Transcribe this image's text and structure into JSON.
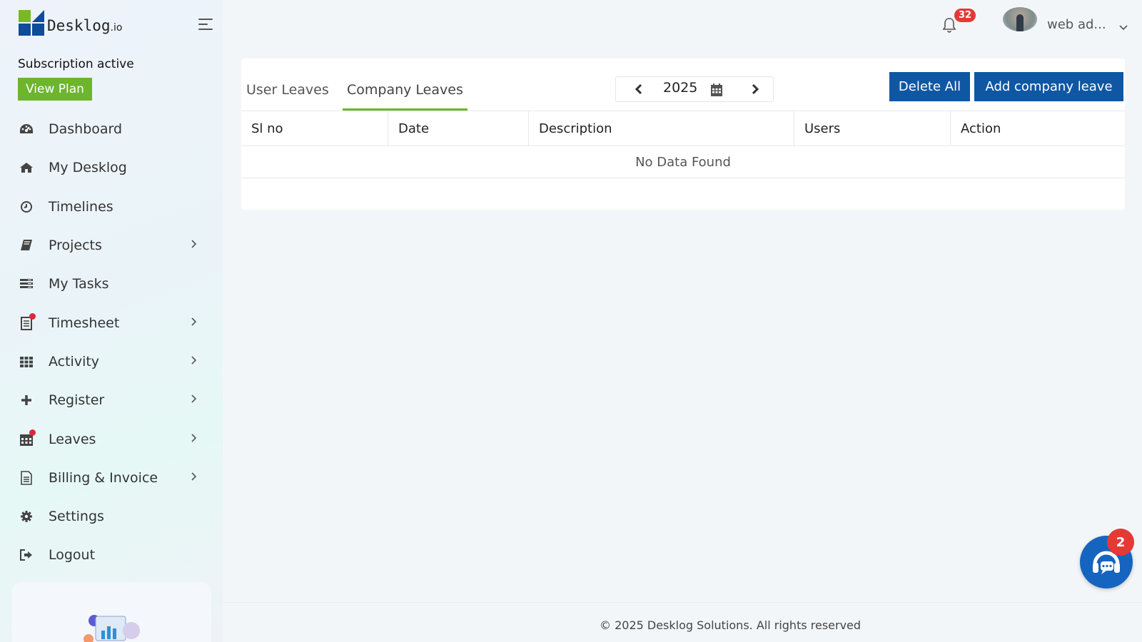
{
  "app": {
    "logo_text": "Desklog",
    "logo_suffix": ".io",
    "subscription_status": "Subscription active",
    "view_plan_label": "View Plan"
  },
  "sidebar": {
    "items": [
      {
        "label": "Dashboard",
        "icon": "dashboard-icon",
        "has_submenu": false
      },
      {
        "label": "My Desklog",
        "icon": "home-icon",
        "has_submenu": false
      },
      {
        "label": "Timelines",
        "icon": "clock-icon",
        "has_submenu": false
      },
      {
        "label": "Projects",
        "icon": "book-icon",
        "has_submenu": true
      },
      {
        "label": "My Tasks",
        "icon": "tasks-icon",
        "has_submenu": false
      },
      {
        "label": "Timesheet",
        "icon": "timesheet-icon",
        "has_submenu": true,
        "notification_dot": true
      },
      {
        "label": "Activity",
        "icon": "grid-icon",
        "has_submenu": true
      },
      {
        "label": "Register",
        "icon": "plus-icon",
        "has_submenu": true
      },
      {
        "label": "Leaves",
        "icon": "calendar-icon",
        "has_submenu": true,
        "notification_dot": true
      },
      {
        "label": "Billing & Invoice",
        "icon": "invoice-icon",
        "has_submenu": true
      },
      {
        "label": "Settings",
        "icon": "gear-icon",
        "has_submenu": false
      },
      {
        "label": "Logout",
        "icon": "logout-icon",
        "has_submenu": false
      }
    ]
  },
  "header": {
    "notification_count": "32",
    "username": "web ad..."
  },
  "leaves": {
    "tabs": [
      {
        "label": "User Leaves",
        "active": false
      },
      {
        "label": "Company Leaves",
        "active": true
      }
    ],
    "year": "2025",
    "delete_all_label": "Delete All",
    "add_label": "Add company leave",
    "columns": [
      "Sl no",
      "Date",
      "Description",
      "Users",
      "Action"
    ],
    "empty_message": "No Data Found"
  },
  "footer": {
    "text": "© 2025 Desklog Solutions. All rights reserved"
  },
  "chat": {
    "badge_count": "2"
  },
  "colors": {
    "accent_green": "#6cb52d",
    "primary_blue": "#0f57a3",
    "badge_red": "#e53935"
  }
}
